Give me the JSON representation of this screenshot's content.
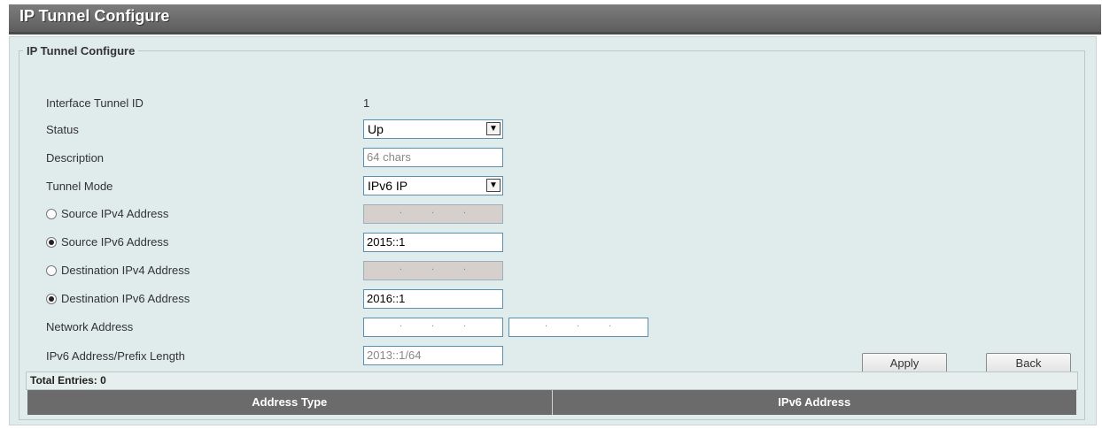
{
  "header": {
    "title": "IP Tunnel Configure"
  },
  "group": {
    "legend": "IP Tunnel Configure"
  },
  "form": {
    "interface_tunnel_id": {
      "label": "Interface Tunnel ID",
      "value": "1"
    },
    "status": {
      "label": "Status",
      "value": "Up"
    },
    "description": {
      "label": "Description",
      "placeholder": "64 chars"
    },
    "tunnel_mode": {
      "label": "Tunnel Mode",
      "value": "IPv6 IP"
    },
    "source_ipv4": {
      "label": "Source IPv4 Address",
      "selected": false
    },
    "source_ipv6": {
      "label": "Source IPv6 Address",
      "selected": true,
      "value": "2015::1"
    },
    "dest_ipv4": {
      "label": "Destination IPv4 Address",
      "selected": false
    },
    "dest_ipv6": {
      "label": "Destination IPv6 Address",
      "selected": true,
      "value": "2016::1"
    },
    "network_address": {
      "label": "Network Address"
    },
    "ipv6_prefix": {
      "label": "IPv6 Address/Prefix Length",
      "placeholder": "2013::1/64"
    }
  },
  "buttons": {
    "apply": "Apply",
    "back": "Back"
  },
  "table": {
    "total_label": "Total Entries: 0",
    "columns": [
      "Address Type",
      "IPv6 Address"
    ]
  }
}
